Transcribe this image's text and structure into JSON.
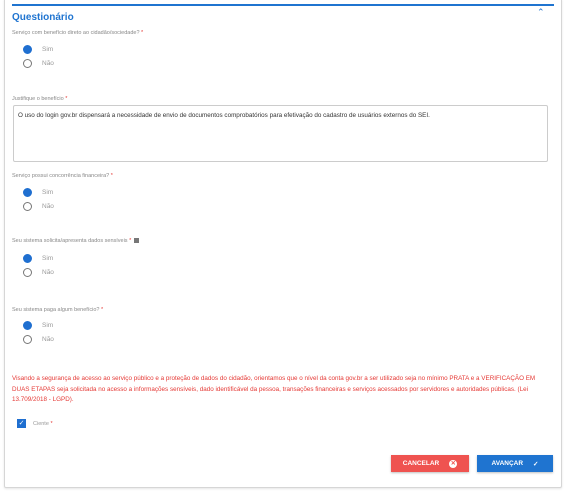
{
  "section": {
    "title": "Questionário"
  },
  "required_mark": "*",
  "questions": [
    {
      "label": "Serviço com benefício direto ao cidadão/sociedade?",
      "options": [
        "Sim",
        "Não"
      ],
      "selected": "Sim"
    },
    {
      "label": "Serviço possui concorrência financeira?",
      "options": [
        "Sim",
        "Não"
      ],
      "selected": "Sim"
    },
    {
      "label": "Seu sistema solicita/apresenta dados sensíveis",
      "options": [
        "Sim",
        "Não"
      ],
      "selected": "Sim"
    },
    {
      "label": "Seu sistema paga algum benefício?",
      "options": [
        "Sim",
        "Não"
      ],
      "selected": "Sim"
    }
  ],
  "justify": {
    "label": "Justifique o benefício",
    "value": "O uso do login gov.br dispensará a necessidade de envio de documentos comprobatórios para efetivação do cadastro de usuários externos do SEI."
  },
  "warning": "Visando a segurança de acesso ao serviço público e a proteção de dados do cidadão, orientamos que o nível da conta gov.br a ser utilizado seja no mínimo PRATA e a VERIFICAÇÃO EM DUAS ETAPAS seja solicitada no acesso a informações sensíveis, dado identificável da pessoa, transações financeiras e serviços acessados por servidores e autoridades públicas. (Lei 13.709/2018 - LGPD).",
  "ciente": {
    "label": "Ciente",
    "checked": true
  },
  "buttons": {
    "cancel": "CANCELAR",
    "advance": "AVANÇAR"
  },
  "colors": {
    "primary": "#1f74d0",
    "danger": "#ef5350"
  }
}
